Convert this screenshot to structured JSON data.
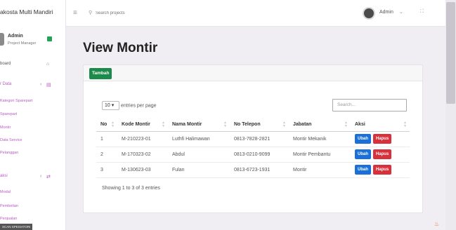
{
  "app": {
    "brand": "akosta Multi Mandiri"
  },
  "profile": {
    "name": "Admin",
    "role": "Project Manager"
  },
  "sidebar": {
    "items": [
      {
        "label": "board",
        "icon": "home-icon"
      },
      {
        "label": "r Data",
        "icon": "database-icon"
      },
      {
        "label": "Kategori Sparepart"
      },
      {
        "label": "Sparepart"
      },
      {
        "label": "Montir"
      },
      {
        "label": "Data Service"
      },
      {
        "label": "Pelanggan"
      },
      {
        "label": "aksi",
        "icon": "transaction-icon"
      },
      {
        "label": "Modal"
      },
      {
        "label": "Pembelian"
      },
      {
        "label": "Penjualan"
      }
    ]
  },
  "topbar": {
    "search_placeholder": "Search projects",
    "user_name": "Admin",
    "user_caret": "⌄"
  },
  "main": {
    "title": "View Montir",
    "add_button": "Tambah",
    "entries_value": "10",
    "entries_label": "entries per page",
    "search_placeholder": "Search...",
    "columns": [
      "No",
      "Kode Montir",
      "Nama Montir",
      "No Telepon",
      "Jabatan",
      "Aksi"
    ],
    "rows": [
      {
        "no": "1",
        "kode": "M-210223-01",
        "nama": "Luthfi Halimawan",
        "telepon": "0813-7828-2821",
        "jabatan": "Montir Mekanik"
      },
      {
        "no": "2",
        "kode": "M-170323-02",
        "nama": "Abdul",
        "telepon": "0813-0210-9099",
        "jabatan": "Montir Pembantu"
      },
      {
        "no": "3",
        "kode": "M-130623-03",
        "nama": "Fulan",
        "telepon": "0813-6723-1931",
        "jabatan": "Montir"
      }
    ],
    "edit_label": "Ubah",
    "delete_label": "Hapus",
    "showing": "Showing 1 to 3 of 3 entries"
  },
  "footer": {
    "tooltip": "SCAN SPESIATORI"
  },
  "colors": {
    "accent": "#b85cc4",
    "primary": "#1a6fd9",
    "danger": "#d8313b",
    "success": "#1c8a4a"
  }
}
